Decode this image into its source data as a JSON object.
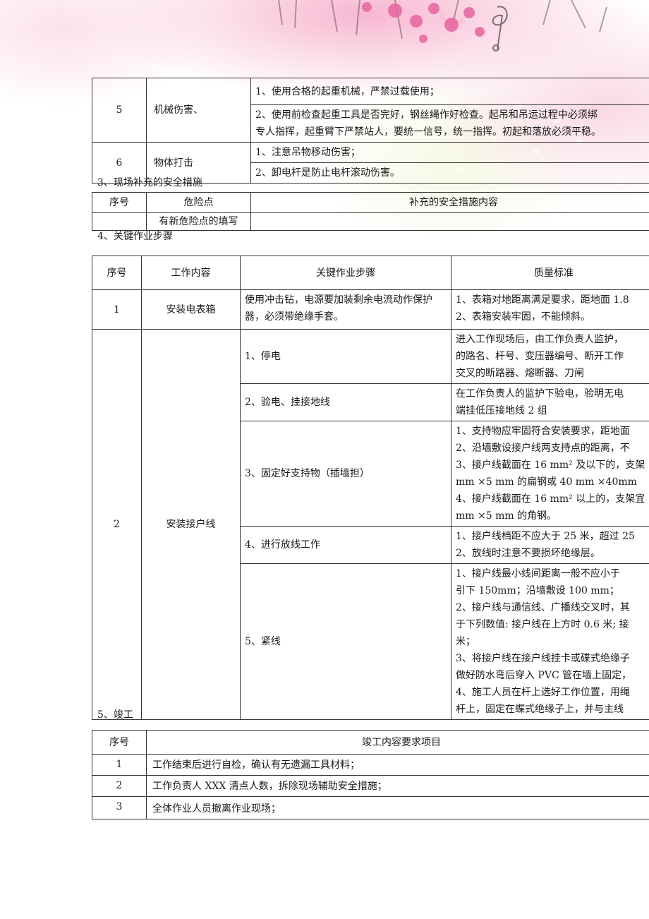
{
  "hazard_table": {
    "rows": [
      {
        "no": "5",
        "hazard": "机械伤害、",
        "measures": [
          "1、使用合格的起重机械，严禁过载使用；",
          "2、使用前检查起重工具是否完好，钢丝绳作好检查。起吊和吊运过程中必须绑",
          "专人指挥，起重臂下严禁站人，要统一信号，统一指挥。初起和落放必须平稳。"
        ]
      },
      {
        "no": "6",
        "hazard": "物体打击",
        "measures": [
          "1、注意吊物移动伤害；",
          "2、卸电杆是防止电杆滚动伤害。"
        ]
      }
    ]
  },
  "section3": {
    "title": "3、现场补充的安全措施",
    "headers": [
      "序号",
      "危险点",
      "补充的安全措施内容"
    ],
    "row": {
      "no": "",
      "hazard": "有新危险点的填写",
      "content": ""
    }
  },
  "section4": {
    "title": "4、关键作业步骤",
    "headers": [
      "序号",
      "工作内容",
      "关键作业步骤",
      "质量标准"
    ],
    "rows": [
      {
        "no": "1",
        "work": "安装电表箱",
        "steps": [
          {
            "step": "使用冲击钻，电源要加装剩余电流动作保护器，必须带绝缘手套。",
            "quality": [
              "1、表箱对地距离满足要求，距地面 1.8",
              "2、表箱安装牢固，不能倾斜。"
            ]
          }
        ]
      },
      {
        "no": "2",
        "work": "安装接户线",
        "steps": [
          {
            "step": "1、停电",
            "quality": [
              "进入工作现场后，由工作负责人监护，",
              "的路名、杆号、变压器编号、断开工作",
              "交叉的断路器、熔断器、刀闸"
            ]
          },
          {
            "step": "2、验电、挂接地线",
            "quality": [
              "在工作负责人的监护下验电，验明无电",
              "端挂低压接地线 2 组"
            ]
          },
          {
            "step": "3、固定好支持物（插墙担）",
            "quality": [
              "1、支持物应牢固符合安装要求，距地面",
              "2、沿墙敷设接户线两支持点的距离，不",
              "3、接户线截面在 16 mm² 及以下的，支架",
              "mm ×5 mm 的扁钢或 40 mm ×40mm",
              "4、接户线截面在 16 mm² 以上的，支架宜",
              "mm ×5 mm 的角钢。"
            ]
          },
          {
            "step": "4、进行放线工作",
            "quality": [
              "1、接户线档距不应大于 25 米，超过 25",
              "2、放线时注意不要损坏绝缘层。"
            ]
          },
          {
            "step": "5、紧线",
            "quality": [
              "1、接户线最小线间距离一般不应小于",
              "引下 150mm；沿墙敷设 100 mm；",
              "2、接户线与通信线、广播线交叉时，其",
              "于下列数值: 接户线在上方时 0.6 米; 接",
              "米；",
              "3、将接户线在接户线挂卡或碟式绝缘子",
              "做好防水弯后穿入 PVC 管在墙上固定，",
              "4、施工人员在杆上选好工作位置，用绳",
              "杆上，固定在蝶式绝缘子上，并与主线"
            ]
          }
        ]
      }
    ]
  },
  "section5": {
    "title": "5、竣工",
    "headers": [
      "序号",
      "竣工内容要求项目"
    ],
    "rows": [
      {
        "no": "1",
        "item": "工作结束后进行自检，确认有无遗漏工具材料；"
      },
      {
        "no": "2",
        "item": "工作负责人 XXX 清点人数，拆除现场辅助安全措施；"
      },
      {
        "no": "3",
        "item": "全体作业人员撤离作业现场；"
      }
    ]
  }
}
